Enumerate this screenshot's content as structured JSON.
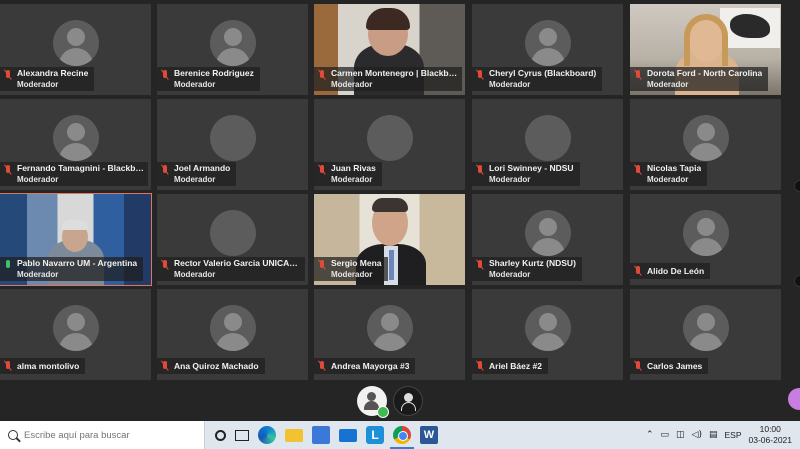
{
  "participants": [
    {
      "name": "Alexandra Recine",
      "role": "Moderador",
      "video": false,
      "mic": "muted"
    },
    {
      "name": "Berenice Rodriguez",
      "role": "Moderador",
      "video": false,
      "mic": "muted"
    },
    {
      "name": "Carmen Montenegro | Blackbo...",
      "role": "Moderador",
      "video": true,
      "mic": "muted"
    },
    {
      "name": "Cheryl Cyrus (Blackboard)",
      "role": "Moderador",
      "video": false,
      "mic": "muted"
    },
    {
      "name": "Dorota Ford - North Carolina",
      "role": "Moderador",
      "video": true,
      "mic": "muted"
    },
    {
      "name": "Fernando Tamagnini - Blackbo...",
      "role": "Moderador",
      "video": false,
      "mic": "muted"
    },
    {
      "name": "Joel Armando",
      "role": "Moderador",
      "video": false,
      "mic": "muted"
    },
    {
      "name": "Juan Rivas",
      "role": "Moderador",
      "video": false,
      "mic": "muted"
    },
    {
      "name": "Lori Swinney - NDSU",
      "role": "Moderador",
      "video": false,
      "mic": "muted"
    },
    {
      "name": "Nicolas Tapia",
      "role": "Moderador",
      "video": false,
      "mic": "muted"
    },
    {
      "name": "Pablo Navarro UM - Argentina",
      "role": "Moderador",
      "video": true,
      "mic": "on"
    },
    {
      "name": "Rector Valerio Garcia UNICARIBE",
      "role": "Moderador",
      "video": false,
      "mic": "muted"
    },
    {
      "name": "Sergio Mena",
      "role": "Moderador",
      "video": true,
      "mic": "muted"
    },
    {
      "name": "Sharley Kurtz (NDSU)",
      "role": "Moderador",
      "video": false,
      "mic": "muted"
    },
    {
      "name": "Alido De León",
      "role": "",
      "video": false,
      "mic": "muted"
    },
    {
      "name": "alma montolivo",
      "role": "",
      "video": false,
      "mic": "muted"
    },
    {
      "name": "Ana Quiroz Machado",
      "role": "",
      "video": false,
      "mic": "muted"
    },
    {
      "name": "Andrea Mayorga #3",
      "role": "",
      "video": false,
      "mic": "muted"
    },
    {
      "name": "Ariel Báez #2",
      "role": "",
      "video": false,
      "mic": "muted"
    },
    {
      "name": "Carlos James",
      "role": "",
      "video": false,
      "mic": "muted"
    }
  ],
  "taskbar": {
    "search_placeholder": "Escribe aquí para buscar",
    "lang": "ESP",
    "time": "10:00",
    "date": "03-06-2021",
    "word_label": "W",
    "lapp_label": "L"
  },
  "colors": {
    "active_speaker_border": "#e0765d",
    "muted_mic": "#e04a3a",
    "live_mic": "#39c26b",
    "tile_bg": "#3a3a3a",
    "stage_bg": "#252525"
  }
}
